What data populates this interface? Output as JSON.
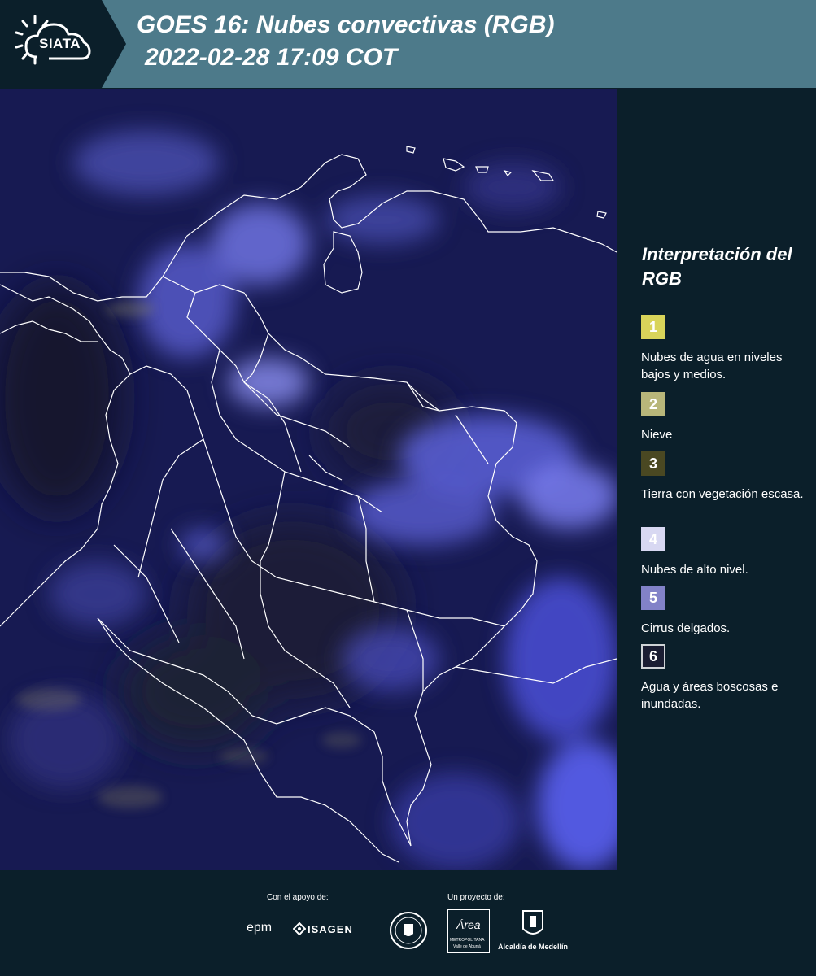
{
  "header": {
    "logo_text": "SIATA",
    "title_line1": "GOES 16: Nubes convectivas (RGB)",
    "title_line2": "2022-02-28 17:09 COT"
  },
  "legend": {
    "title": "Interpretación del RGB",
    "items": [
      {
        "number": "1",
        "label": "Nubes de agua en niveles bajos y medios.",
        "color": "#d9d45a"
      },
      {
        "number": "2",
        "label": "Nieve",
        "color": "#b8b67a"
      },
      {
        "number": "3",
        "label": "Tierra con vegetación escasa.",
        "color": "#4a4822"
      },
      {
        "number": "4",
        "label": "Nubes de alto nivel.",
        "color": "#d8d8f2"
      },
      {
        "number": "5",
        "label": "Cirrus delgados.",
        "color": "#8282c8"
      },
      {
        "number": "6",
        "label": "Agua y áreas boscosas e inundadas.",
        "color": "#1a1d32"
      }
    ]
  },
  "footer": {
    "support_label": "Con el apoyo de:",
    "project_label": "Un proyecto de:",
    "sponsor1": "epm",
    "sponsor2": "ISAGEN",
    "partner_metro_1": "Área",
    "partner_metro_2": "METROPOLITANA",
    "partner_metro_3": "Valle de Aburrá",
    "partner_alcaldia": "Alcaldía de Medellín"
  },
  "colors": {
    "header_bg": "#4d7a8a",
    "page_bg": "#0b1f2a",
    "map_base": "#171a52"
  }
}
